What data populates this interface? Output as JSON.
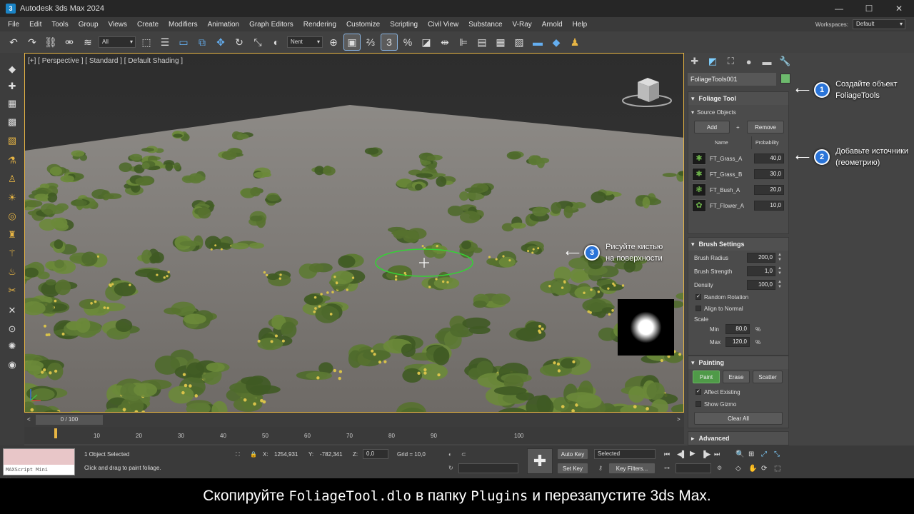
{
  "window": {
    "title": "Autodesk 3ds Max 2024",
    "app_icon": "3ds-max-icon"
  },
  "menu": [
    "File",
    "Edit",
    "Tools",
    "Group",
    "Views",
    "Create",
    "Modifiers",
    "Animation",
    "Graph Editors",
    "Rendering",
    "Customize",
    "Scripting",
    "Civil View",
    "Substance",
    "V-Ray",
    "Arnold",
    "Help"
  ],
  "workspaces": {
    "label": "Workspaces:",
    "value": "Default"
  },
  "toolbar": {
    "selection_filter": "All",
    "named_set": "Nent"
  },
  "viewport": {
    "label": "[+] [ Perspective ] [ Standard ] [ Default Shading ]"
  },
  "panel": {
    "object_name": "FoliageTools001",
    "object_color": "#6dba6d",
    "foliage_tool": {
      "title": "Foliage Tool"
    },
    "source_objects": {
      "title": "Source Objects",
      "add": "Add",
      "plus": "+",
      "remove": "Remove",
      "col_name": "Name",
      "col_prob": "Probability",
      "rows": [
        {
          "name": "FT_Grass_A",
          "prob": "40,0"
        },
        {
          "name": "FT_Grass_B",
          "prob": "30,0"
        },
        {
          "name": "FT_Bush_A",
          "prob": "20,0"
        },
        {
          "name": "FT_Flower_A",
          "prob": "10,0"
        }
      ]
    },
    "brush": {
      "title": "Brush Settings",
      "radius_label": "Brush Radius",
      "radius": "200,0",
      "strength_label": "Brush Strength",
      "strength": "1,0",
      "density_label": "Density",
      "density": "100,0",
      "random_rotation": "Random Rotation",
      "align_normal": "Align to Normal",
      "scale_label": "Scale",
      "min_label": "Min",
      "min": "80,0",
      "max_label": "Max",
      "max": "120,0",
      "pct": "%"
    },
    "painting": {
      "title": "Painting",
      "paint": "Paint",
      "erase": "Erase",
      "scatter": "Scatter",
      "affect_existing": "Affect Existing",
      "show_gizmo": "Show Gizmo",
      "clear_all": "Clear All"
    },
    "advanced": {
      "title": "Advanced"
    }
  },
  "callouts": {
    "c1": {
      "num": "1",
      "line1": "Создайте объект",
      "line2": "FoliageTools"
    },
    "c2": {
      "num": "2",
      "line1": "Добавьте источники",
      "line2": "(геометрию)"
    },
    "c3": {
      "num": "3",
      "line1": "Рисуйте кистью",
      "line2": "на поверхности"
    }
  },
  "timeline": {
    "slider": "0 / 100",
    "ticks": [
      "10",
      "20",
      "30",
      "40",
      "50",
      "60",
      "70",
      "80",
      "90",
      "100"
    ]
  },
  "status": {
    "maxscript": "MAXScript Mini Listener",
    "selected": "1 Object Selected",
    "prompt": "Click and drag to paint foliage.",
    "x_label": "X:",
    "x": "1254,931",
    "y_label": "Y:",
    "y": "-782,341",
    "z_label": "Z:",
    "z": "0,0",
    "grid": "Grid = 10,0",
    "auto_key": "Auto Key",
    "set_key": "Set Key",
    "selected_dd": "Selected",
    "key_filters": "Key Filters..."
  },
  "caption": {
    "pre": "Скопируйте",
    "file": "FoliageTool.dlo",
    "mid": "в папку",
    "folder": "Plugins",
    "post": "и перезапустите 3ds Max."
  }
}
